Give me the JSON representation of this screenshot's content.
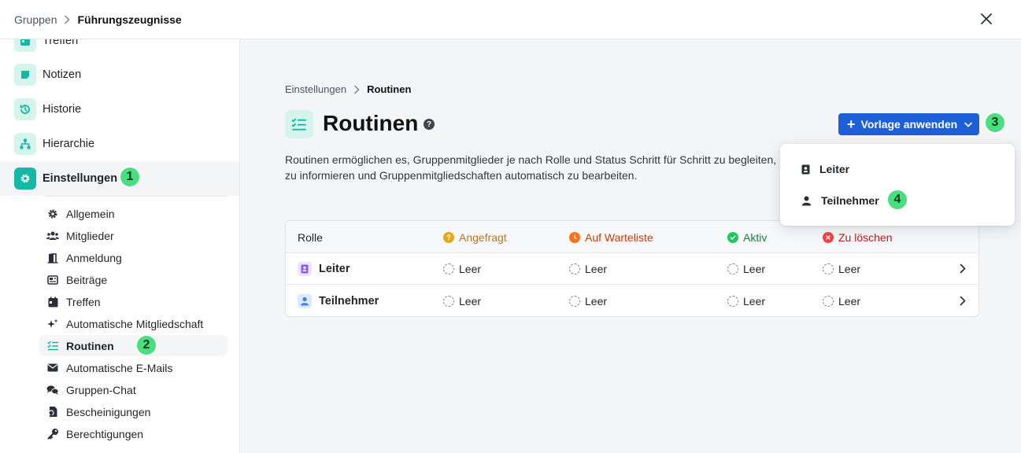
{
  "topbar": {
    "breadcrumb_parent": "Gruppen",
    "breadcrumb_current": "Führungszeugnisse"
  },
  "sidebar": {
    "items": [
      {
        "label": "Treffen",
        "icon": "calendar-icon"
      },
      {
        "label": "Notizen",
        "icon": "note-icon"
      },
      {
        "label": "Historie",
        "icon": "history-icon"
      },
      {
        "label": "Hierarchie",
        "icon": "hierarchy-icon"
      },
      {
        "label": "Einstellungen",
        "icon": "gear-icon"
      }
    ],
    "settings_items": [
      {
        "label": "Allgemein",
        "icon": "gear-icon"
      },
      {
        "label": "Mitglieder",
        "icon": "users-icon"
      },
      {
        "label": "Anmeldung",
        "icon": "door-icon"
      },
      {
        "label": "Beiträge",
        "icon": "newspaper-icon"
      },
      {
        "label": "Treffen",
        "icon": "calendar-icon"
      },
      {
        "label": "Automatische Mitgliedschaft",
        "icon": "sparkles-icon"
      },
      {
        "label": "Routinen",
        "icon": "checklist-icon"
      },
      {
        "label": "Automatische E-Mails",
        "icon": "envelope-icon"
      },
      {
        "label": "Gruppen-Chat",
        "icon": "chat-icon"
      },
      {
        "label": "Bescheinigungen",
        "icon": "certificate-icon"
      },
      {
        "label": "Berechtigungen",
        "icon": "key-icon"
      }
    ]
  },
  "badges": [
    "1",
    "2",
    "3",
    "4"
  ],
  "main": {
    "breadcrumb_parent": "Einstellungen",
    "breadcrumb_current": "Routinen",
    "title": "Routinen",
    "help_icon": "?",
    "description": "Routinen ermöglichen es, Gruppenmitglieder je nach Rolle und Status Schritt für Schritt zu begleiten, zu informieren und Gruppenmitgliedschaften automatisch zu bearbeiten.",
    "apply_button": "Vorlage anwenden"
  },
  "table": {
    "headers": {
      "role": "Rolle",
      "requested": "Angefragt",
      "waitlist": "Auf Warteliste",
      "active": "Aktiv",
      "delete": "Zu löschen"
    },
    "rows": [
      {
        "role": "Leiter",
        "cells": [
          "Leer",
          "Leer",
          "Leer",
          "Leer"
        ]
      },
      {
        "role": "Teilnehmer",
        "cells": [
          "Leer",
          "Leer",
          "Leer",
          "Leer"
        ]
      }
    ]
  },
  "dropdown": {
    "items": [
      {
        "label": "Leiter",
        "icon": "badge-icon"
      },
      {
        "label": "Teilnehmer",
        "icon": "person-icon"
      }
    ]
  },
  "colors": {
    "accent": "#14b8a6",
    "primary_button": "#1d5fd6",
    "requested": "#e6a817",
    "waitlist": "#f97316",
    "active": "#22c55e",
    "delete": "#ef4444",
    "delete_text": "#b91c1c",
    "badge": "#4ade80"
  }
}
